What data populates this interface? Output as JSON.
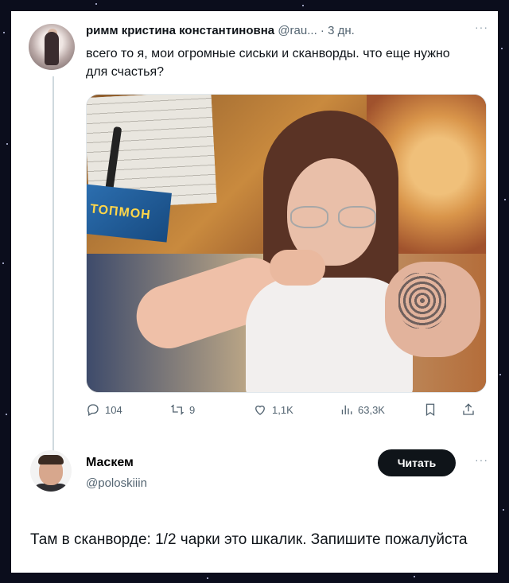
{
  "tweet": {
    "author_name": "римм кристина константиновна",
    "author_handle": "@rau...",
    "time": "· 3 дн.",
    "text": "всего то я, мои огромные сиськи и сканворды. что еще нужно для счастья?",
    "media": {
      "book_text": "ТОПМОН"
    },
    "stats": {
      "replies": "104",
      "reposts": "9",
      "likes": "1,1K",
      "views": "63,3K"
    }
  },
  "reply": {
    "author_name": "Маскем",
    "author_handle": "@poloskiiin",
    "follow_label": "Читать",
    "text": "Там в сканворде: 1/2 чарки это шкалик. Запишите пожалуйста"
  },
  "icons": {
    "reply": "reply-icon",
    "repost": "repost-icon",
    "like": "heart-icon",
    "views": "bar-chart-icon",
    "bookmark": "bookmark-icon",
    "share": "share-icon",
    "more": "more-icon"
  }
}
